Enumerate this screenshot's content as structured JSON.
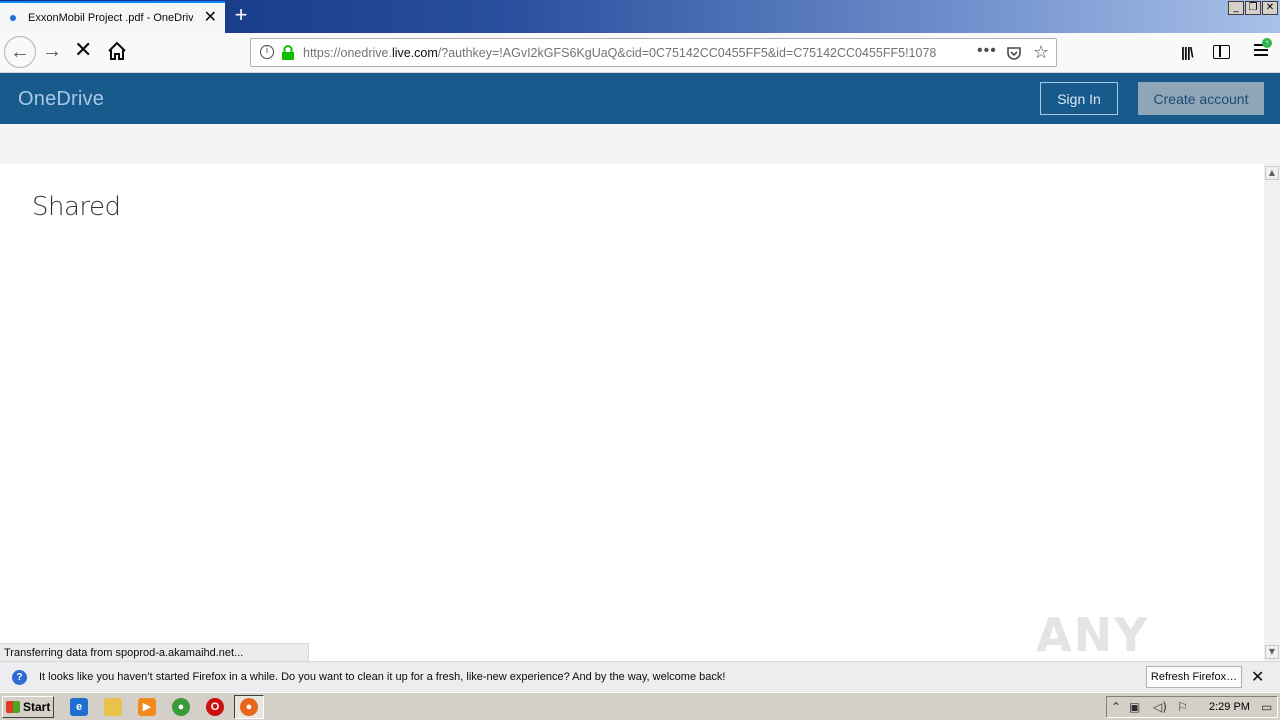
{
  "browser": {
    "tab_title": "ExxonMobil Project .pdf - OneDrive",
    "new_tab_symbol": "+",
    "url_prefix": "https://onedrive.",
    "url_host": "live.com",
    "url_suffix": "/?authkey=!AGvI2kGFS6KgUaQ&cid=0C75142CC0455FF5&id=C75142CC0455FF5!1078",
    "page_actions_symbol": "•••"
  },
  "onedrive": {
    "brand": "OneDrive",
    "sign_in": "Sign In",
    "create_account": "Create account",
    "page_title": "Shared"
  },
  "status_text": "Transferring data from spoprod-a.akamaihd.net...",
  "watermark": "ANY RUN",
  "notification": {
    "text": "It looks like you haven’t started Firefox in a while. Do you want to clean it up for a fresh, like-new experience? And by the way, welcome back!",
    "button": "Refresh Firefox…"
  },
  "taskbar": {
    "start": "Start",
    "clock": "2:29 PM"
  },
  "colors": {
    "onedrive_blue": "#185a8c",
    "accent": "#0a84ff"
  }
}
